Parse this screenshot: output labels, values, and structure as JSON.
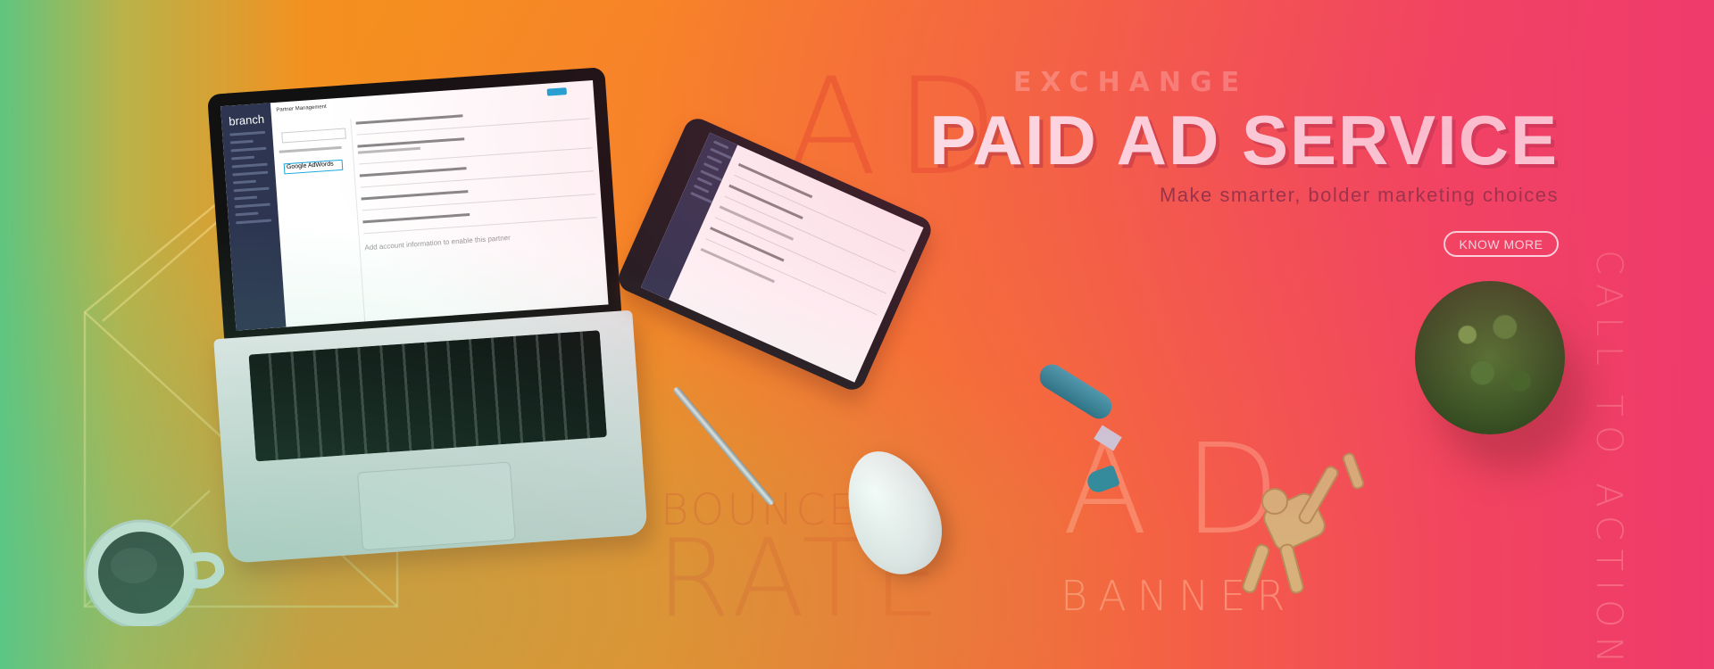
{
  "hero": {
    "title": "PAID AD SERVICE",
    "subtitle": "Make smarter, bolder marketing choices",
    "cta_label": "KNOW MORE"
  },
  "watermarks": {
    "ad_top": "AD",
    "exchange": "EXCHANGE",
    "bounce": "BOUNCE",
    "rate": "RATE",
    "ad_bottom": "AD",
    "banner": "BANNER",
    "call_to_action": "CALL TO ACTION"
  },
  "laptop_screen": {
    "logo": "branch",
    "section_title": "Partner Management",
    "selected_partner": "Google AdWords",
    "note": "Add account information to enable this partner"
  },
  "colors": {
    "gradient_start": "#5fc57f",
    "gradient_mid": "#f88a22",
    "gradient_end": "#ee3a6c",
    "title": "#ffffff",
    "subtitle": "#7d2f3e"
  }
}
